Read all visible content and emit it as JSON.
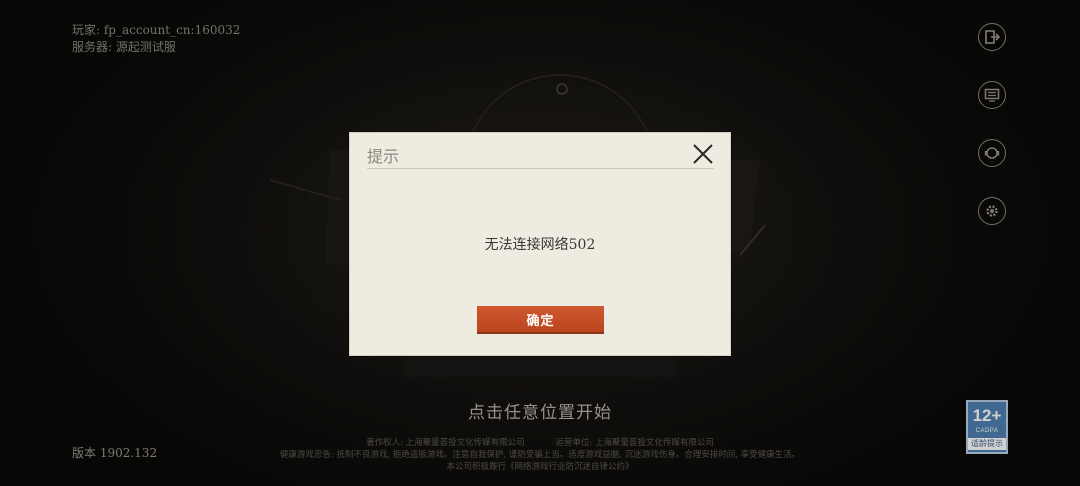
{
  "player": {
    "account_line": "玩家: fp_account_cn:160032",
    "server_line": "服务器: 源起测试服"
  },
  "version": "版本 1902.132",
  "side_icons": [
    "logout-icon",
    "notice-board-icon",
    "customer-service-icon",
    "settings-gear-icon"
  ],
  "tap_to_start": "点击任意位置开始",
  "footer": {
    "copyright": "著作权人: 上海聚量荟投文化传媒有限公司",
    "operator": "运营单位: 上海聚量荟投文化传媒有限公司",
    "health_notice": "健康游戏忠告: 抵制不良游戏, 拒绝盗版游戏。注意自我保护, 谨防受骗上当。适度游戏益脑, 沉迷游戏伤身。合理安排时间, 享受健康生活。",
    "self_discipline": "本公司积极履行《网络游戏行业防沉迷自律公约》"
  },
  "age_rating": {
    "age": "12+",
    "org": "CADPA",
    "tip": "适龄提示"
  },
  "dialog": {
    "title": "提示",
    "message": "无法连接网络502",
    "confirm_label": "确定"
  },
  "colors": {
    "dialog_bg": "#eeebe0",
    "confirm_button": "#c94f27",
    "age_badge": "#4f7fb0"
  }
}
